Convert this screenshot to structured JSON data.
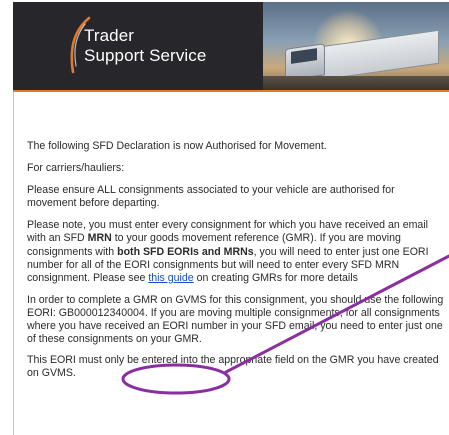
{
  "brand": {
    "line1": "Trader",
    "line2": "Support Service"
  },
  "email": {
    "intro": "The following SFD Declaration is now Authorised for Movement.",
    "carriers_heading": "For carriers/hauliers:",
    "ensure": "Please ensure ALL consignments associated to your vehicle are authorised for movement before departing.",
    "note": {
      "part1": "Please note, you must enter every consignment for which you have received an email with an SFD ",
      "mrn": "MRN",
      "part2": " to your goods movement reference (GMR). If you are moving consignments with ",
      "both": "both SFD EORIs and MRNs",
      "part3": ", you will need to enter just one EORI number for all of the EORI consignments but will need to enter every SFD MRN consignment. Please see ",
      "link": "this guide",
      "part4": " on creating GMRs for more details"
    },
    "gmr": {
      "part1": "In order to complete a GMR on GVMS for this consignment, you should use the following EORI: ",
      "eori": "GB000012340004",
      "part2": ". If you are moving multiple consignments, for all consignments where you have received an EORI number in your SFD email, you need to enter just one of these consignments on your GMR."
    },
    "final": "This EORI must only be entered into the appropriate field on the GMR you have created on GVMS."
  },
  "colors": {
    "banner": "#26262b",
    "accent_rule": "#e07a2c",
    "link": "#1a4dcc",
    "highlight": "#8a2fa0"
  }
}
